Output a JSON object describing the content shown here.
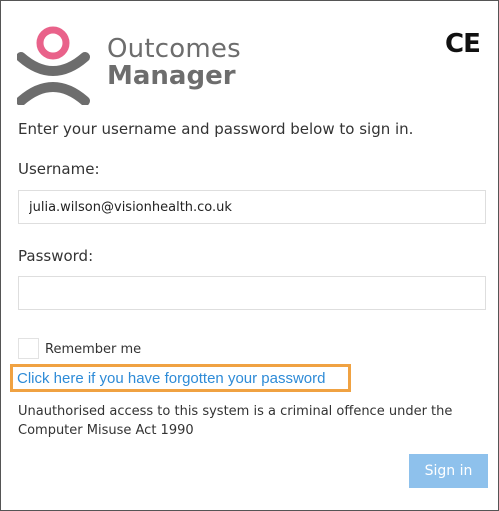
{
  "brand": {
    "name_top": "Outcomes",
    "name_bottom": "Manager",
    "logo_icon": "outcomes-manager-logo-icon",
    "colors": {
      "pink": "#e9628a",
      "grey": "#6d6d6d"
    }
  },
  "ce_mark": "CE",
  "intro_text": "Enter your username and password below to sign in.",
  "username": {
    "label": "Username:",
    "value": "julia.wilson@visionhealth.co.uk",
    "placeholder": ""
  },
  "password": {
    "label": "Password:",
    "value": "",
    "placeholder": ""
  },
  "remember": {
    "label": "Remember me",
    "checked": false
  },
  "forgot_link": {
    "label": "Click here if you have forgotten your password",
    "highlight_color": "#f0a242",
    "color": "#2e8bd7"
  },
  "notice_text": "Unauthorised access to this system is a criminal offence under the Computer Misuse Act 1990",
  "signin_button": {
    "label": "Sign in",
    "color": "#8ec1ec"
  }
}
